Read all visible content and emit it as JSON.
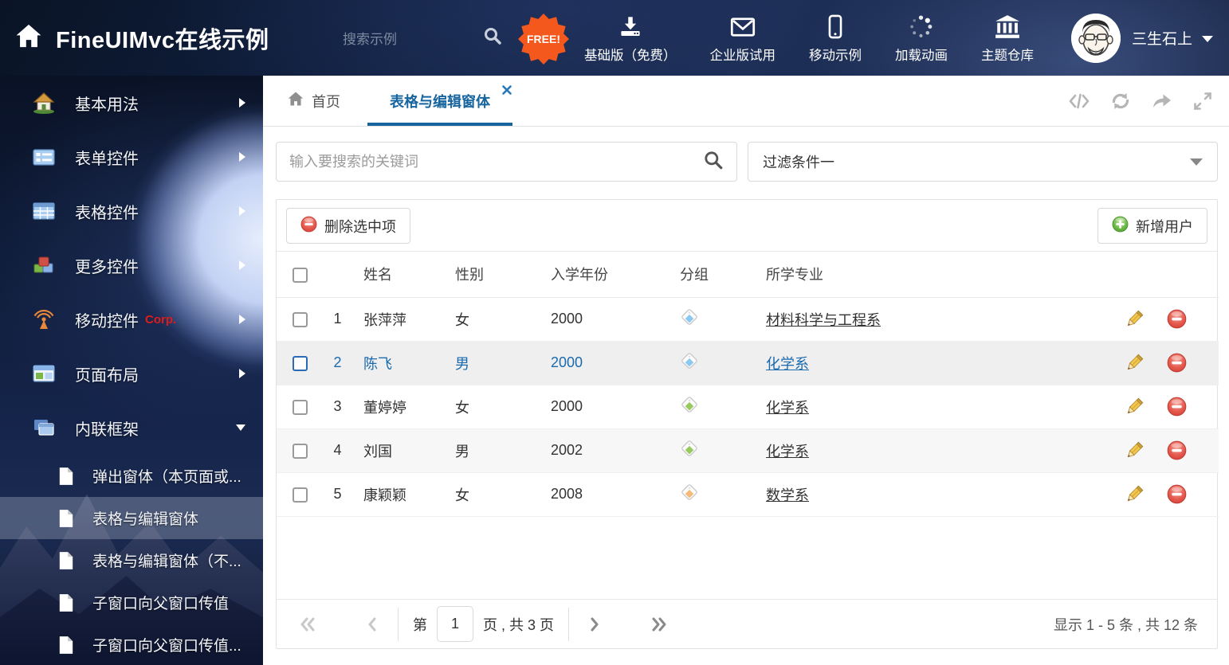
{
  "colors": {
    "accent": "#1a6aae",
    "free_badge": "#f4581c",
    "delete_red": "#dd4b42",
    "add_green": "#5aa73c"
  },
  "header": {
    "title": "FineUIMvc在线示例",
    "search_placeholder": "搜索示例",
    "free_badge": "FREE!",
    "nav": [
      {
        "label": "基础版（免费）",
        "icon": "download-icon"
      },
      {
        "label": "企业版试用",
        "icon": "envelope-icon"
      },
      {
        "label": "移动示例",
        "icon": "phone-icon"
      },
      {
        "label": "加载动画",
        "icon": "spinner-icon"
      },
      {
        "label": "主题仓库",
        "icon": "bank-icon"
      }
    ],
    "user": {
      "name": "三生石上"
    }
  },
  "sidebar": {
    "items": [
      {
        "label": "基本用法",
        "icon": "home-icon"
      },
      {
        "label": "表单控件",
        "icon": "form-icon"
      },
      {
        "label": "表格控件",
        "icon": "table-icon"
      },
      {
        "label": "更多控件",
        "icon": "cubes-icon"
      },
      {
        "label": "移动控件",
        "badge": "Corp.",
        "icon": "antenna-icon"
      },
      {
        "label": "页面布局",
        "icon": "layout-icon"
      },
      {
        "label": "内联框架",
        "icon": "windows-icon",
        "expanded": true
      }
    ],
    "subitems": [
      {
        "label": "弹出窗体（本页面或..."
      },
      {
        "label": "表格与编辑窗体",
        "active": true
      },
      {
        "label": "表格与编辑窗体（不..."
      },
      {
        "label": "子窗口向父窗口传值"
      },
      {
        "label": "子窗口向父窗口传值..."
      }
    ]
  },
  "tabs": {
    "home": "首页",
    "active": "表格与编辑窗体"
  },
  "filters": {
    "search_placeholder": "输入要搜索的关键词",
    "filter_value": "过滤条件一"
  },
  "toolbar": {
    "delete_label": "删除选中项",
    "add_label": "新增用户"
  },
  "table": {
    "columns": [
      "姓名",
      "性别",
      "入学年份",
      "分组",
      "所学专业"
    ],
    "tag_colors": {
      "blue": "#8cc8f0",
      "green": "#97c95c",
      "orange": "#f5b97a"
    },
    "rows": [
      {
        "num": "1",
        "name": "张萍萍",
        "gender": "女",
        "year": "2000",
        "tag": "blue",
        "major": "材料科学与工程系",
        "selected": false,
        "striped": false
      },
      {
        "num": "2",
        "name": "陈飞",
        "gender": "男",
        "year": "2000",
        "tag": "blue",
        "major": "化学系",
        "selected": true,
        "striped": true
      },
      {
        "num": "3",
        "name": "董婷婷",
        "gender": "女",
        "year": "2000",
        "tag": "green",
        "major": "化学系",
        "selected": false,
        "striped": false
      },
      {
        "num": "4",
        "name": "刘国",
        "gender": "男",
        "year": "2002",
        "tag": "green",
        "major": "化学系",
        "selected": false,
        "striped": true
      },
      {
        "num": "5",
        "name": "康颖颖",
        "gender": "女",
        "year": "2008",
        "tag": "orange",
        "major": "数学系",
        "selected": false,
        "striped": false
      }
    ]
  },
  "pagination": {
    "label_page": "第",
    "page_value": "1",
    "label_total": "页 , 共 3 页",
    "summary": "显示 1 - 5 条 , 共 12 条"
  }
}
